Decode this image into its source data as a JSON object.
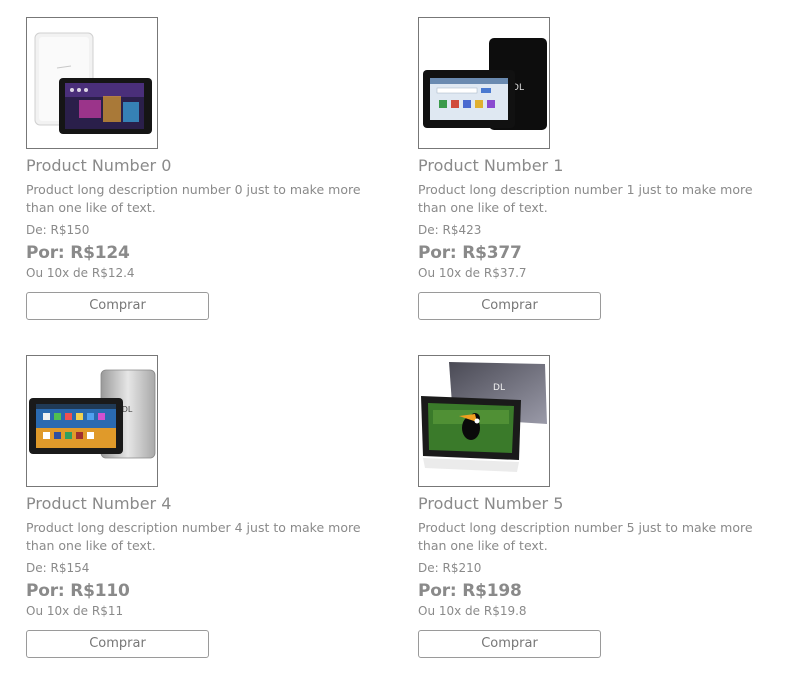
{
  "products": [
    {
      "title": "Product Number 0",
      "description": "Product long description number 0 just to make more than one like of text.",
      "old_price": "De: R$150",
      "price": "Por: R$124",
      "installments": "Ou 10x de R$12.4",
      "buy_label": "Comprar",
      "image": "white-and-black-tablets"
    },
    {
      "title": "Product Number 1",
      "description": "Product long description number 1 just to make more than one like of text.",
      "old_price": "De: R$423",
      "price": "Por: R$377",
      "installments": "Ou 10x de R$37.7",
      "buy_label": "Comprar",
      "image": "black-tablet-pair"
    },
    {
      "title": "Product Number 4",
      "description": "Product long description number 4 just to make more than one like of text.",
      "old_price": "De: R$154",
      "price": "Por: R$110",
      "installments": "Ou 10x de R$11",
      "buy_label": "Comprar",
      "image": "silver-tablet-pair"
    },
    {
      "title": "Product Number 5",
      "description": "Product long description number 5 just to make more than one like of text.",
      "old_price": "De: R$210",
      "price": "Por: R$198",
      "installments": "Ou 10x de R$19.8",
      "buy_label": "Comprar",
      "image": "gray-tablet-with-toucan"
    }
  ]
}
